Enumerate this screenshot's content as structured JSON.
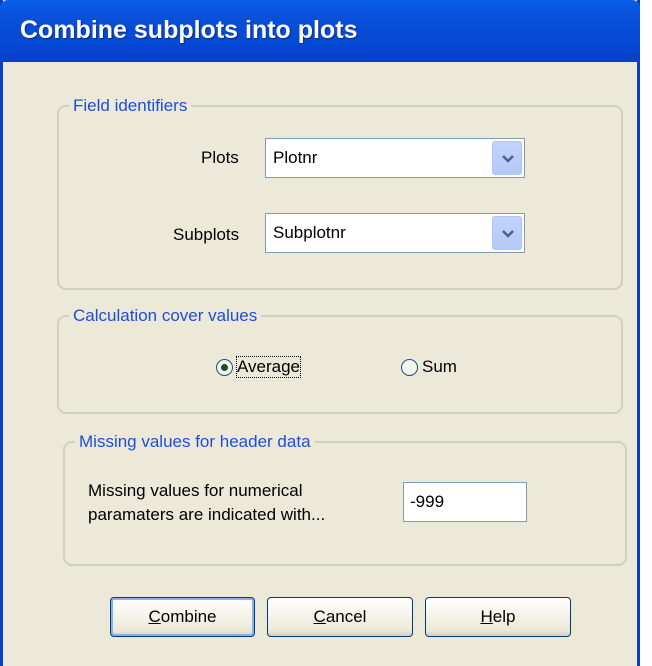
{
  "window": {
    "title": "Combine subplots into plots"
  },
  "field_identifiers": {
    "legend": "Field identifiers",
    "plots_label": "Plots",
    "plots_value": "Plotnr",
    "subplots_label": "Subplots",
    "subplots_value": "Subplotnr"
  },
  "calculation": {
    "legend": "Calculation cover values",
    "options": [
      {
        "label": "Average",
        "selected": true
      },
      {
        "label": "Sum",
        "selected": false
      }
    ]
  },
  "missing": {
    "legend": "Missing values for header data",
    "line1": "Missing values for numerical",
    "line2": "paramaters are indicated with...",
    "value": "-999"
  },
  "buttons": {
    "combine": {
      "first": "C",
      "rest": "ombine"
    },
    "cancel": {
      "first": "C",
      "rest": "ancel"
    },
    "help": {
      "first": "H",
      "rest": "elp"
    }
  },
  "colors": {
    "titlebar": "#0a4fd8",
    "legend_text": "#1d4fd6",
    "dialog_bg": "#ece9d8"
  }
}
